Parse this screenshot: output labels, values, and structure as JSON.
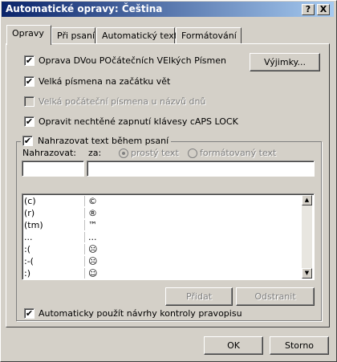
{
  "window": {
    "title": "Automatické opravy: Čeština",
    "help_btn": "?",
    "close_btn": "X"
  },
  "tabs": [
    {
      "label": "Opravy"
    },
    {
      "label": "Při psaní"
    },
    {
      "label": "Automatický text"
    },
    {
      "label": "Formátování"
    }
  ],
  "options": {
    "twocaps_label": "Oprava DVou POčátečních VElkých Písmen",
    "sentence_label": "Velká písmena na začátku vět",
    "days_label": "Velká počáteční písmena u názvů dnů",
    "capslock_label": "Opravit nechtěné zapnutí klávesy cAPS LOCK",
    "exceptions_btn": "Výjimky..."
  },
  "replace": {
    "group_label": "Nahrazovat text během psaní",
    "col_replace": "Nahrazovat:",
    "col_with": "za:",
    "radio_plain": "prostý text",
    "radio_formatted": "formátovaný text",
    "replace_value": "",
    "with_value": "",
    "rows": [
      {
        "from": "(c)",
        "to": "©"
      },
      {
        "from": "(r)",
        "to": "®"
      },
      {
        "from": "(tm)",
        "to": "™"
      },
      {
        "from": "...",
        "to": "..."
      },
      {
        "from": ":(",
        "to": "☹"
      },
      {
        "from": ":-(",
        "to": "☹"
      },
      {
        "from": ":)",
        "to": "☺"
      }
    ],
    "add_btn": "Přidat",
    "delete_btn": "Odstranit",
    "suggest_label": "Automaticky použít návrhy kontroly pravopisu"
  },
  "footer": {
    "ok_btn": "OK",
    "cancel_btn": "Storno"
  },
  "icons": {
    "scroll_up": "up-arrow-icon",
    "scroll_down": "down-arrow-icon"
  },
  "colors": {
    "titlebar_start": "#0a246a",
    "titlebar_end": "#a6caf0",
    "face": "#d4d0c8"
  }
}
